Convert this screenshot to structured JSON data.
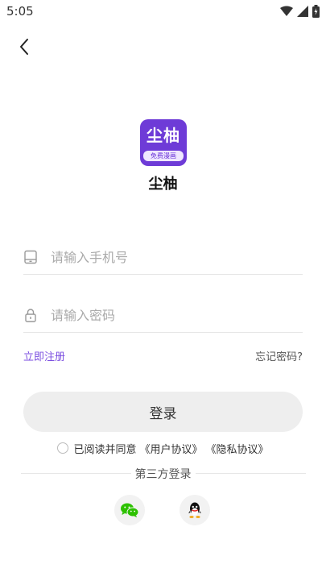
{
  "status": {
    "time": "5:05"
  },
  "app": {
    "logo_main": "尘柚",
    "logo_tag": "免费漫画",
    "name": "尘柚"
  },
  "form": {
    "phone_placeholder": "请输入手机号",
    "password_placeholder": "请输入密码",
    "register_label": "立即注册",
    "forgot_label": "忘记密码?",
    "login_label": "登录"
  },
  "agreement": {
    "prefix": "已阅读并同意",
    "user_agreement": "《用户协议》",
    "privacy_policy": "《隐私协议》"
  },
  "third_party": {
    "title": "第三方登录"
  },
  "colors": {
    "accent": "#7b4ee0",
    "wechat": "#2dc100",
    "logo_bg": "#6e3bd7"
  }
}
